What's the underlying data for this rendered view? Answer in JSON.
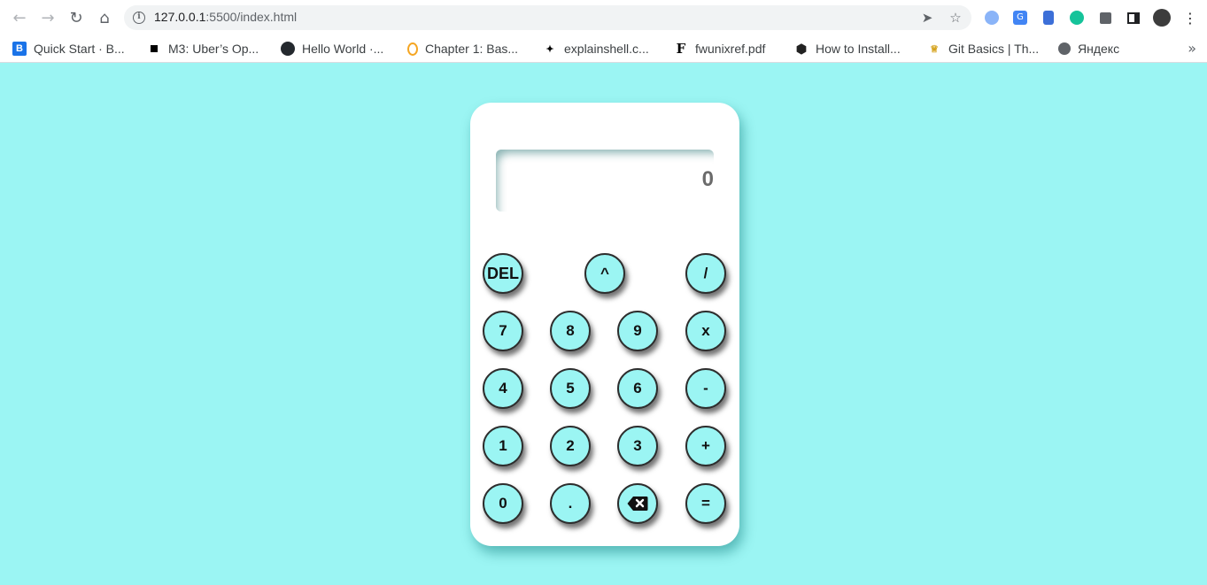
{
  "browser": {
    "url_host": "127.0.0.1",
    "url_rest": ":5500/index.html",
    "bookmarks": [
      {
        "label": "Quick Start · B...",
        "icon": "bootstrap-icon"
      },
      {
        "label": "M3: Uber’s Op...",
        "icon": "black-square-icon"
      },
      {
        "label": "Hello World ·...",
        "icon": "github-icon"
      },
      {
        "label": "Chapter 1: Bas...",
        "icon": "orange-ring-icon"
      },
      {
        "label": "explainshell.c...",
        "icon": "shell-icon"
      },
      {
        "label": "fwunixref.pdf",
        "icon": "f-icon"
      },
      {
        "label": "How to Install...",
        "icon": "hexagon-icon"
      },
      {
        "label": "Git Basics | Th...",
        "icon": "odin-icon"
      },
      {
        "label": "Яндекс",
        "icon": "globe-icon"
      }
    ]
  },
  "calculator": {
    "display_value": "0",
    "keys": {
      "del": "DEL",
      "power": "^",
      "divide": "/",
      "seven": "7",
      "eight": "8",
      "nine": "9",
      "multiply": "x",
      "four": "4",
      "five": "5",
      "six": "6",
      "subtract": "-",
      "one": "1",
      "two": "2",
      "three": "3",
      "add": "+",
      "zero": "0",
      "decimal": ".",
      "equals": "="
    }
  },
  "colors": {
    "page_background": "#9bf5f3",
    "key_background": "#9bf5f3",
    "panel_background": "#ffffff"
  }
}
